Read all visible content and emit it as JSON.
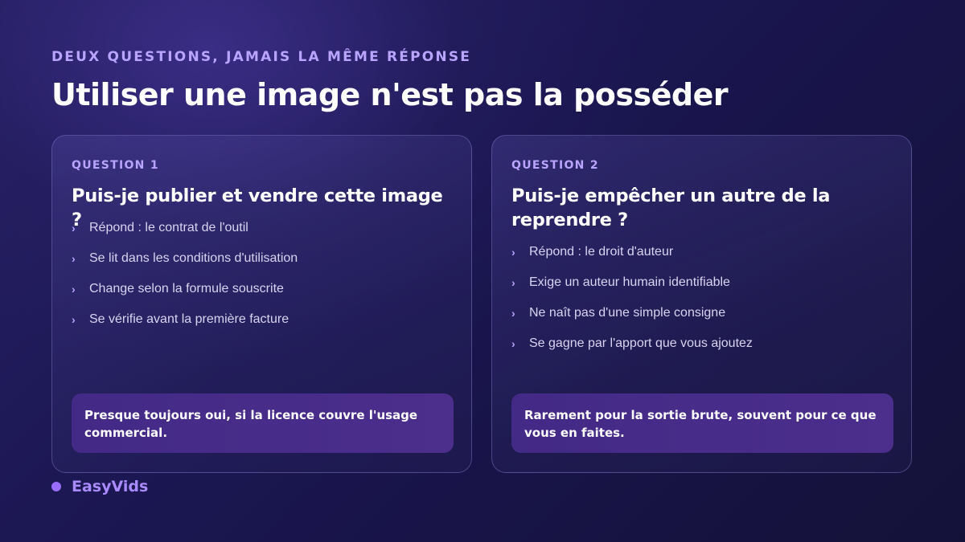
{
  "header": {
    "eyebrow": "DEUX QUESTIONS, JAMAIS LA MÊME RÉPONSE",
    "title": "Utiliser une image n'est pas la posséder"
  },
  "cards": [
    {
      "label": "QUESTION 1",
      "question": "Puis-je publier et vendre cette image ?",
      "bullets": [
        "Répond : le contrat de l'outil",
        "Se lit dans les conditions d'utilisation",
        "Change selon la formule souscrite",
        "Se vérifie avant la première facture"
      ],
      "answer": "Presque toujours oui, si la licence couvre l'usage commercial."
    },
    {
      "label": "QUESTION 2",
      "question": "Puis-je empêcher un autre de la reprendre ?",
      "bullets": [
        "Répond : le droit d'auteur",
        "Exige un auteur humain identifiable",
        "Ne naît pas d'une simple consigne",
        "Se gagne par l'apport que vous ajoutez"
      ],
      "answer": "Rarement pour la sortie brute, souvent pour ce que vous en faites."
    }
  ],
  "bullet_icon": "chevron-right-icon",
  "brand": {
    "name": "EasyVids",
    "dot_color": "#9a6cff"
  },
  "colors": {
    "accent": "#b9a4ff",
    "answer_bg": "#462c88",
    "background": "#1a1650"
  }
}
